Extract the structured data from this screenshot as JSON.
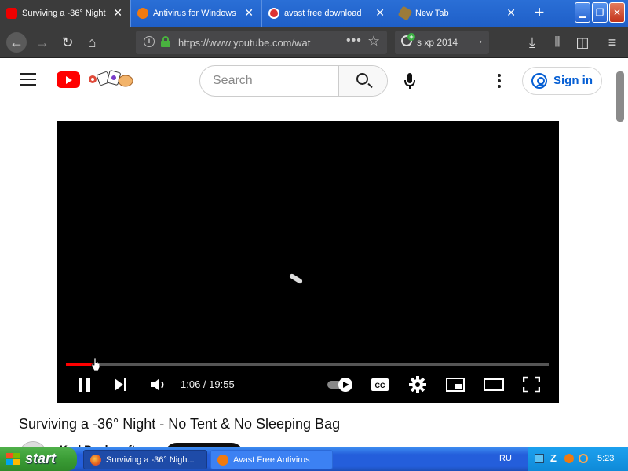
{
  "browser": {
    "tabs": [
      {
        "title": "Surviving a -36° Night",
        "icon": "youtube-favicon",
        "active": true
      },
      {
        "title": "Antivirus for Windows",
        "icon": "avast-favicon",
        "active": false
      },
      {
        "title": "avast free download",
        "icon": "google-favicon",
        "active": false
      },
      {
        "title": "New Tab",
        "icon": "newtab-favicon",
        "active": false
      }
    ],
    "new_tab_glyph": "+",
    "close_glyph": "✕",
    "url": "https://www.youtube.com/wat",
    "search_query": "s xp 2014"
  },
  "youtube": {
    "search_placeholder": "Search",
    "signin_label": "Sign in",
    "player": {
      "current_time": "1:06",
      "duration": "19:55",
      "time_display": "1:06 / 19:55",
      "progress_fraction": 0.055
    },
    "video_title": "Surviving a -36° Night - No Tent & No Sleeping Bag",
    "channel_name": "Kral Bushcraft"
  },
  "taskbar": {
    "start_label": "start",
    "tasks": [
      {
        "title": "Surviving a -36° Nigh...",
        "icon": "firefox-icon"
      },
      {
        "title": "Avast Free Antivirus",
        "icon": "avast-icon"
      }
    ],
    "language": "RU",
    "clock": "5:23"
  },
  "colors": {
    "xp_blue": "#245edb",
    "start_green": "#3a9c35",
    "yt_red": "#ff0000",
    "link_blue": "#065fd4"
  }
}
